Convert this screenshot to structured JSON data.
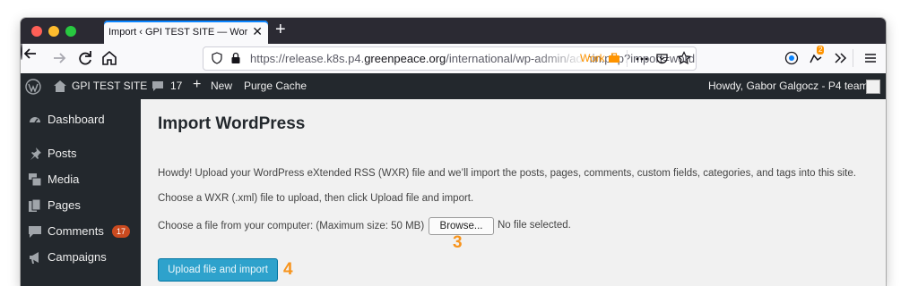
{
  "browser": {
    "tab_title": "Import ‹ GPI TEST SITE — WordPress",
    "tab_close": "✕",
    "new_tab": "+",
    "url_prefix": "https://release.k8s.p4.",
    "url_domain": "greenpeace.org",
    "url_path": "/international/wp-admin/admin.php?import=wordpress",
    "container_label": "Work",
    "extension_badge": "2",
    "icons": [
      "back-arrow-icon",
      "forward-arrow-icon",
      "reload-icon",
      "home-icon",
      "shield-icon",
      "lock-icon",
      "briefcase-icon",
      "more-icon",
      "pocket-icon",
      "star-icon",
      "extension-icon",
      "overflow-icon",
      "hamburger-menu-icon"
    ]
  },
  "adminbar": {
    "site_name": "GPI TEST SITE",
    "comments_count": "17",
    "new_label": "New",
    "purge_label": "Purge Cache",
    "greeting": "Howdy, Gabor Galgocz - P4 team"
  },
  "sidebar": {
    "items": [
      {
        "label": "Dashboard",
        "icon": "dashboard-icon"
      },
      {
        "label": "Posts",
        "icon": "pin-icon"
      },
      {
        "label": "Media",
        "icon": "media-icon"
      },
      {
        "label": "Pages",
        "icon": "pages-icon"
      },
      {
        "label": "Comments",
        "icon": "comment-icon",
        "count": "17"
      },
      {
        "label": "Campaigns",
        "icon": "megaphone-icon"
      }
    ]
  },
  "main": {
    "title": "Import WordPress",
    "intro": "Howdy! Upload your WordPress eXtended RSS (WXR) file and we’ll import the posts, pages, comments, custom fields, categories, and tags into this site.",
    "instruction": "Choose a WXR (.xml) file to upload, then click Upload file and import.",
    "file_label": "Choose a file from your computer: (Maximum size: 50 MB)",
    "browse_label": "Browse...",
    "no_file": "No file selected.",
    "upload_label": "Upload file and import",
    "step_browse": "3",
    "step_upload": "4"
  },
  "colors": {
    "admin_dark": "#23282d",
    "primary_button": "#2ea2cc",
    "annotation": "#f7941d",
    "comment_bubble": "#ca4a1f"
  }
}
